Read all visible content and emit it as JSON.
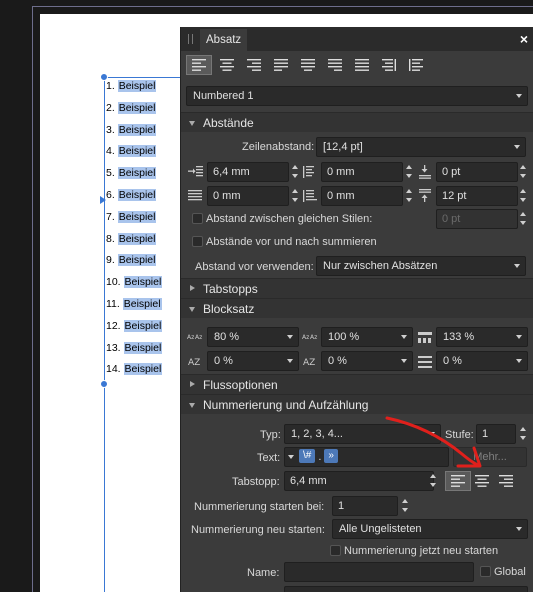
{
  "panel": {
    "tab_label": "Absatz",
    "close_label": "×",
    "style_dropdown": "Numbered 1"
  },
  "document": {
    "list_items": [
      {
        "num": "1.",
        "text": "Beispiel"
      },
      {
        "num": "2.",
        "text": "Beispiel"
      },
      {
        "num": "3.",
        "text": "Beispiel"
      },
      {
        "num": "4.",
        "text": "Beispiel"
      },
      {
        "num": "5.",
        "text": "Beispiel"
      },
      {
        "num": "6.",
        "text": "Beispiel"
      },
      {
        "num": "7.",
        "text": "Beispiel"
      },
      {
        "num": "8.",
        "text": "Beispiel"
      },
      {
        "num": "9.",
        "text": "Beispiel"
      },
      {
        "num": "10.",
        "text": "Beispiel"
      },
      {
        "num": "11.",
        "text": "Beispiel"
      },
      {
        "num": "12.",
        "text": "Beispiel"
      },
      {
        "num": "13.",
        "text": "Beispiel"
      },
      {
        "num": "14.",
        "text": "Beispiel"
      }
    ]
  },
  "abstaende": {
    "title": "Abstände",
    "zeilenabstand_label": "Zeilenabstand:",
    "zeilenabstand_value": "[12,4 pt]",
    "indent_left": "6,4 mm",
    "indent_first": "0 mm",
    "space_before": "0 pt",
    "indent_right": "0 mm",
    "indent_last": "0 mm",
    "space_after": "12 pt",
    "same_style_label": "Abstand zwischen gleichen Stilen:",
    "same_style_value": "0 pt",
    "sum_label": "Abstände vor und nach summieren",
    "use_before_label": "Abstand vor verwenden:",
    "use_before_value": "Nur zwischen Absätzen"
  },
  "tabstopps": {
    "title": "Tabstopps"
  },
  "blocksatz": {
    "title": "Blocksatz",
    "row1": [
      "80 %",
      "100 %",
      "133 %"
    ],
    "row2": [
      "0 %",
      "0 %",
      "0 %"
    ]
  },
  "flussoptionen": {
    "title": "Flussoptionen"
  },
  "nummerierung": {
    "title": "Nummerierung und Aufzählung",
    "typ_label": "Typ:",
    "typ_value": "1, 2, 3, 4...",
    "stufe_label": "Stufe:",
    "stufe_value": "1",
    "text_label": "Text:",
    "text_token_1": "\\#",
    "text_dot": ".",
    "text_token_2": "»",
    "mehr_label": "Mehr...",
    "tabstopp_label": "Tabstopp:",
    "tabstopp_value": "6,4 mm",
    "start_label": "Nummerierung starten bei:",
    "start_value": "1",
    "restart_label": "Nummerierung neu starten:",
    "restart_value": "Alle Ungelisteten",
    "restart_now_label": "Nummerierung jetzt neu starten",
    "name_label": "Name:",
    "name_value": "",
    "global_label": "Global"
  },
  "colors": {
    "panel_bg": "#3b3b3b",
    "accent": "#3a78d4",
    "annotation": "#e0201c"
  }
}
